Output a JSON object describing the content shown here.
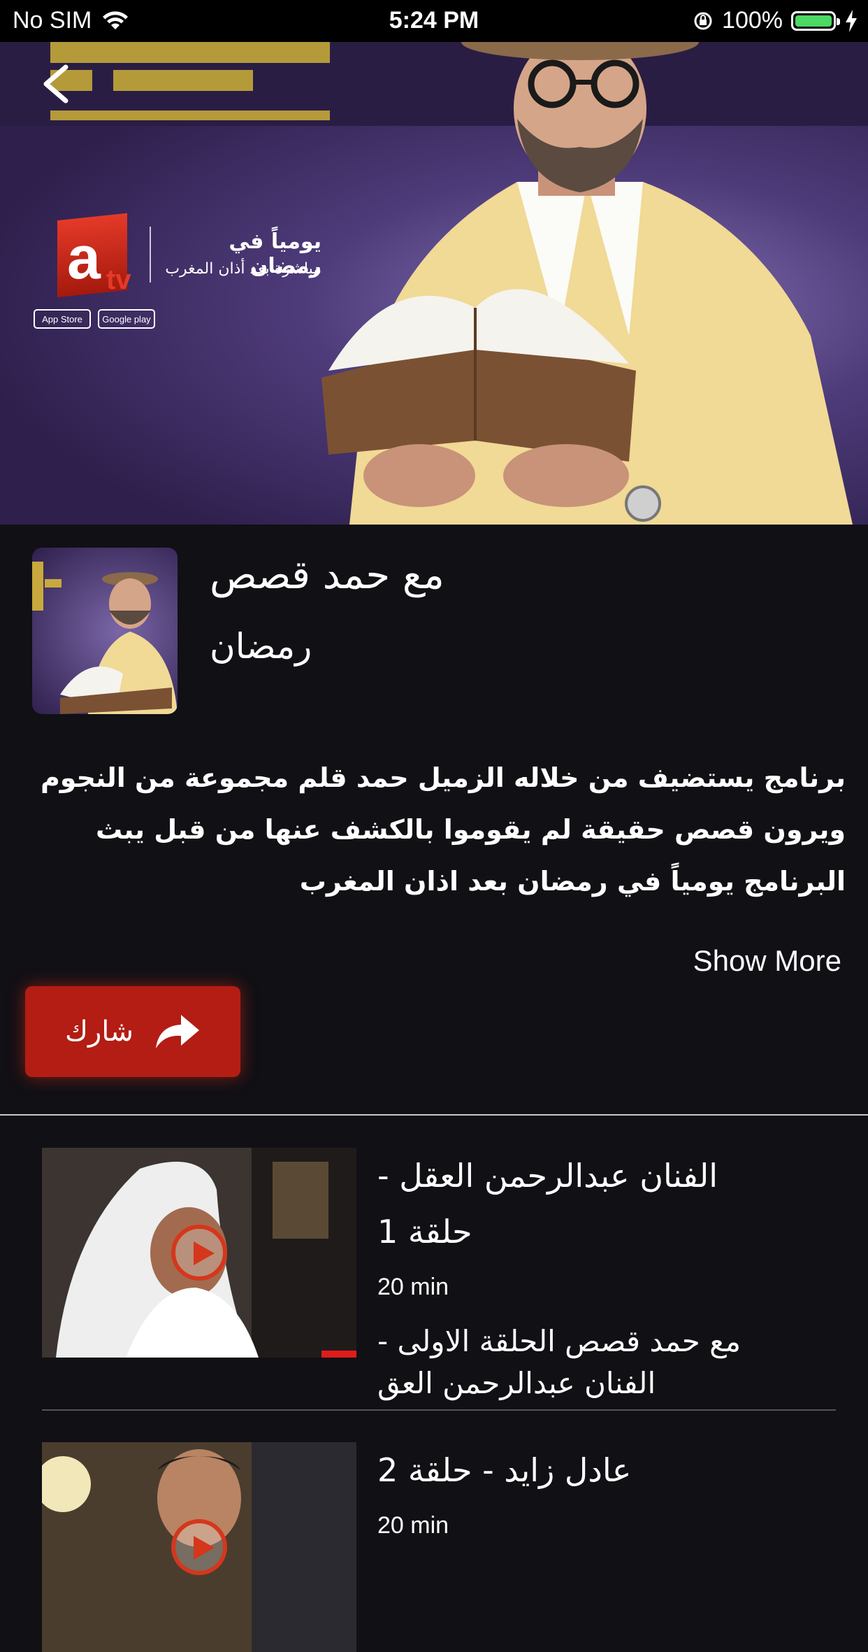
{
  "status_bar": {
    "carrier": "No SIM",
    "time": "5:24 PM",
    "battery": "100%"
  },
  "banner": {
    "channel_logo": "a",
    "channel_logo_suffix": "tv",
    "line1": "يومياً في رمضان",
    "line2": "مباشرة بعد أذان المغرب",
    "app_store": "App Store",
    "google_play": "Google play"
  },
  "show": {
    "title": "مع حمد قصص",
    "category": "رمضان",
    "description": "برنامج يستضيف من خلاله الزميل حمد قلم مجموعة من النجوم ويرون قصص حقيقة لم يقوموا بالكشف عنها من قبل يبث البرنامج يومياً في رمضان بعد اذان المغرب",
    "show_more": "Show More",
    "share_label": "شارك"
  },
  "episodes": [
    {
      "title_line1": "الفنان عبدالرحمن العقل -",
      "title_line2": "حلقة 1",
      "duration": "20 min",
      "desc_line1": "مع حمد قصص الحلقة الاولى -",
      "desc_line2": "الفنان عبدالرحمن العق"
    },
    {
      "title_line1": "عادل زايد - حلقة 2",
      "duration": "20 min"
    }
  ],
  "colors": {
    "background": "#111015",
    "share_button": "#b31d13",
    "accent_gold": "#b59a3a"
  }
}
